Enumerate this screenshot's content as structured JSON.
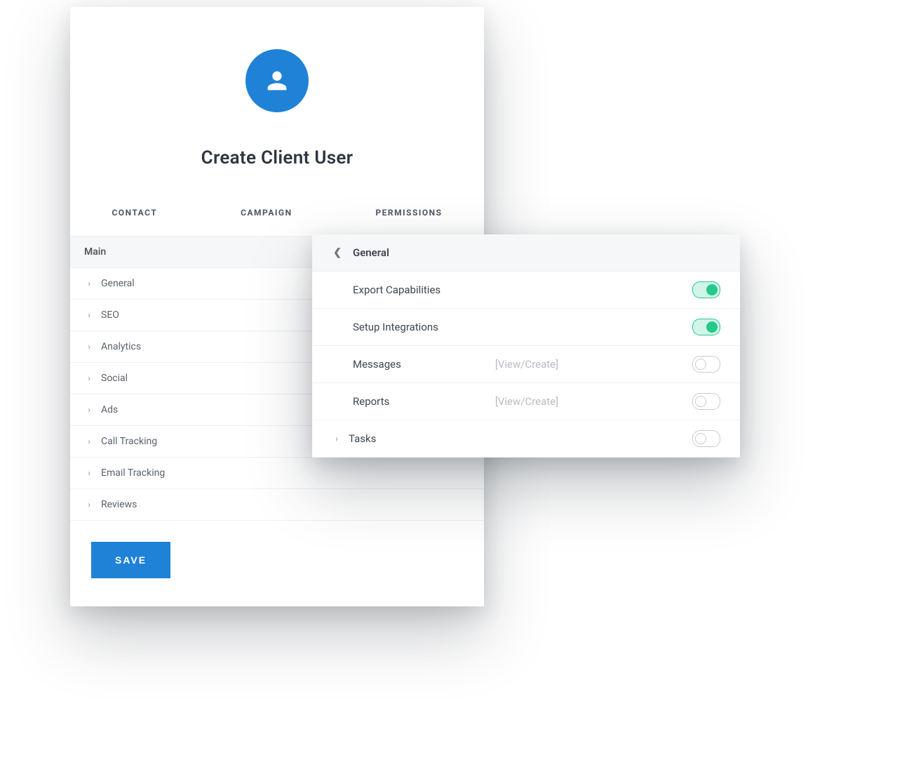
{
  "title": "Create Client User",
  "tabs": {
    "contact": "CONTACT",
    "campaign": "CAMPAIGN",
    "permissions": "PERMISSIONS"
  },
  "list_header": "Main",
  "categories": [
    {
      "label": "General"
    },
    {
      "label": "SEO"
    },
    {
      "label": "Analytics"
    },
    {
      "label": "Social"
    },
    {
      "label": "Ads"
    },
    {
      "label": "Call Tracking"
    },
    {
      "label": "Email Tracking"
    },
    {
      "label": "Reviews"
    }
  ],
  "save_label": "SAVE",
  "panel": {
    "title": "General",
    "items": [
      {
        "label": "Export Capabilities",
        "hint": "",
        "on": true,
        "expandable": false
      },
      {
        "label": "Setup Integrations",
        "hint": "",
        "on": true,
        "expandable": false
      },
      {
        "label": "Messages",
        "hint": "[View/Create]",
        "on": false,
        "expandable": false
      },
      {
        "label": "Reports",
        "hint": "[View/Create]",
        "on": false,
        "expandable": false
      },
      {
        "label": "Tasks",
        "hint": "",
        "on": false,
        "expandable": true
      }
    ]
  },
  "colors": {
    "accent": "#1f82d6",
    "toggle_on": "#24c98b"
  }
}
